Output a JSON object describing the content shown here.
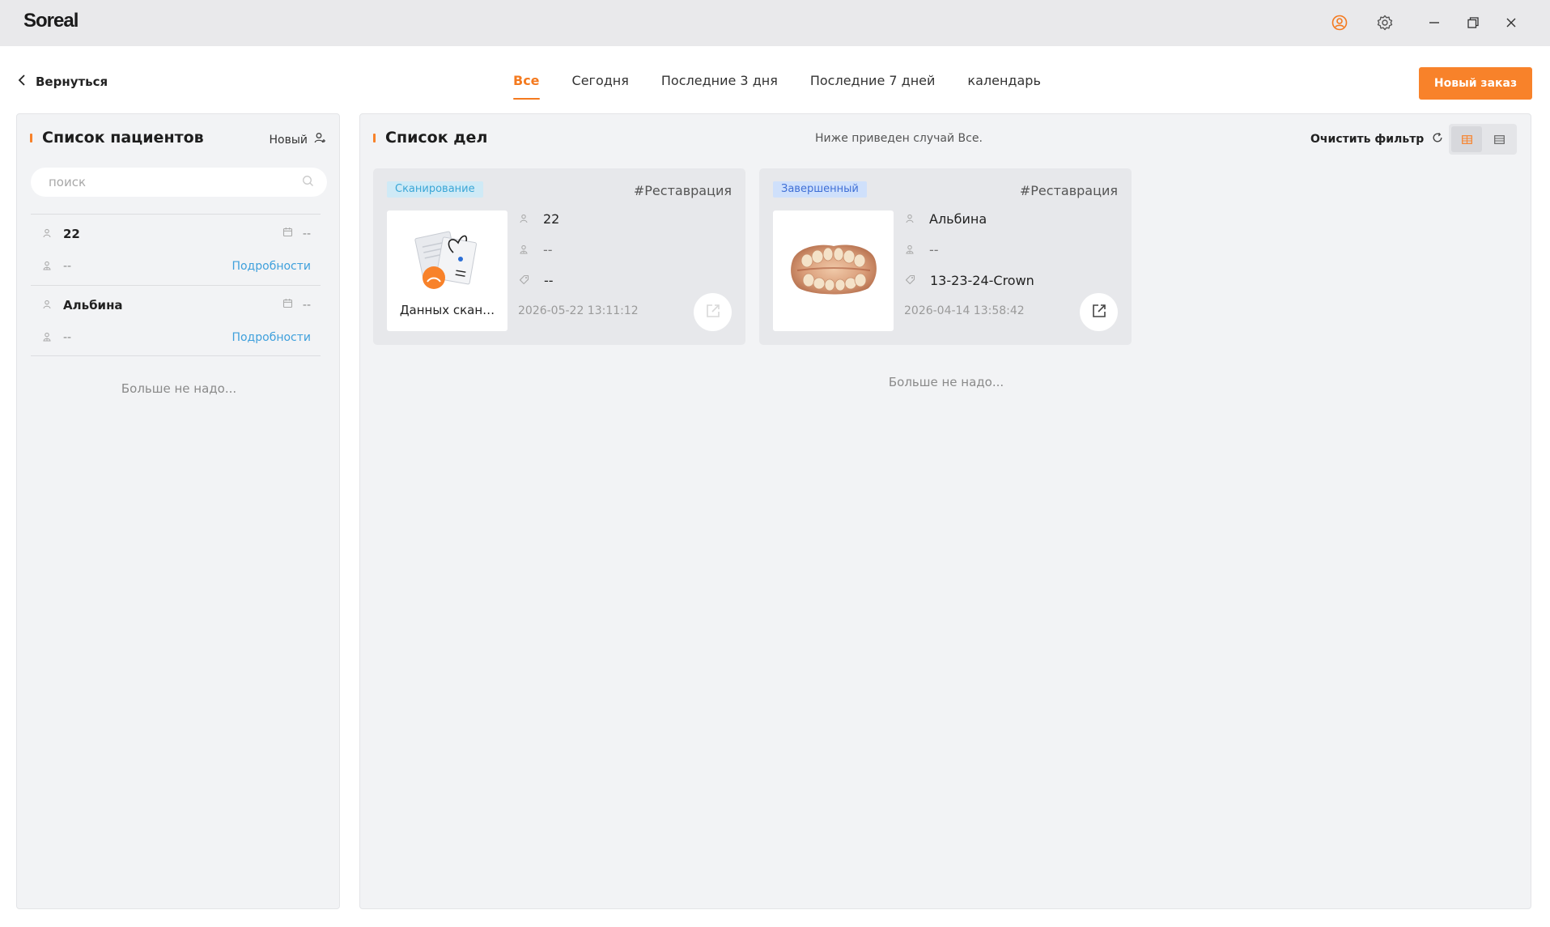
{
  "app": {
    "logo": "Soreal"
  },
  "nav": {
    "back_label": "Вернуться",
    "tabs": [
      {
        "label": "Все",
        "active": true
      },
      {
        "label": "Сегодня",
        "active": false
      },
      {
        "label": "Последние 3 дня",
        "active": false
      },
      {
        "label": "Последние 7 дней",
        "active": false
      },
      {
        "label": "календарь",
        "active": false
      }
    ],
    "new_order_label": "Новый заказ"
  },
  "patients_panel": {
    "title": "Список пациентов",
    "new_label": "Новый",
    "search_placeholder": "поиск",
    "patients": [
      {
        "name": "22",
        "date": "--",
        "doctor": "--",
        "details_label": "Подробности"
      },
      {
        "name": "Альбина",
        "date": "--",
        "doctor": "--",
        "details_label": "Подробности"
      }
    ],
    "no_more": "Больше не надо..."
  },
  "cases_panel": {
    "title": "Список дел",
    "description": "Ниже приведен случай Все.",
    "clear_filter_label": "Очистить фильтр",
    "cards": [
      {
        "status": "Сканирование",
        "tag": "#Реставрация",
        "thumb_label": "Данных скан…",
        "patient": "22",
        "doctor": "--",
        "product": "--",
        "date": "2026-05-22 13:11:12"
      },
      {
        "status": "Завершенный",
        "tag": "#Реставрация",
        "thumb_label": "",
        "patient": "Альбина",
        "doctor": "--",
        "product": "13-23-24-Crown",
        "date": "2026-04-14 13:58:42"
      }
    ],
    "no_more": "Больше не надо..."
  },
  "colors": {
    "accent": "#f8822a",
    "link": "#3fa0dc",
    "scan_status": "#3aa6d6",
    "done_status": "#3f6fd6"
  },
  "icons": [
    "user-circle-icon",
    "gear-icon",
    "minimize-icon",
    "restore-icon",
    "close-icon",
    "chevron-left-icon",
    "add-user-icon",
    "search-icon",
    "person-icon",
    "calendar-icon",
    "doctor-icon",
    "tag-icon",
    "share-icon",
    "refresh-icon",
    "grid-view-icon",
    "list-view-icon"
  ]
}
